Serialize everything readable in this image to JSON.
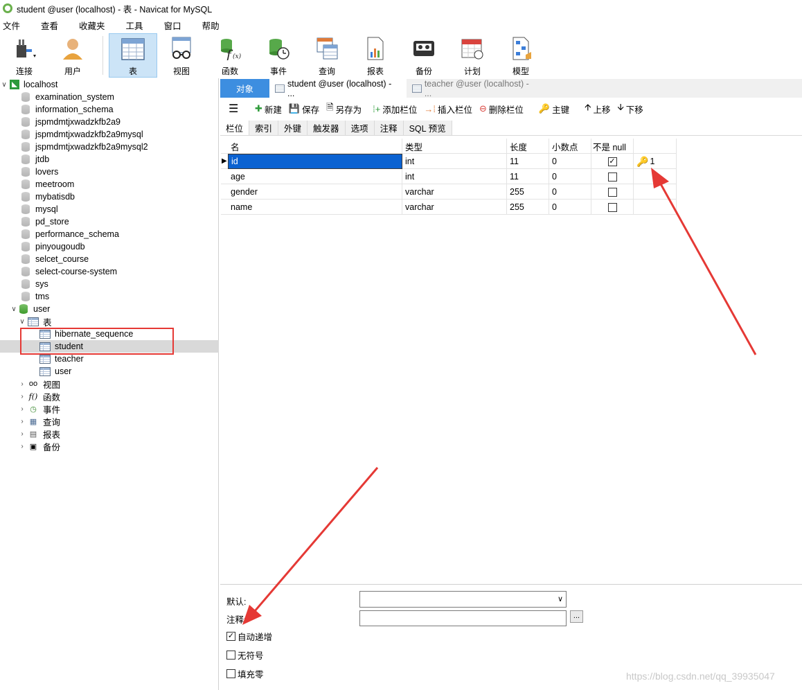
{
  "window": {
    "title": "student @user (localhost) - 表 - Navicat for MySQL"
  },
  "menu": [
    "文件",
    "查看",
    "收藏夹",
    "工具",
    "窗口",
    "帮助"
  ],
  "toolbar": {
    "connect": "连接",
    "user": "用户",
    "table": "表",
    "view": "视图",
    "function": "函数",
    "event": "事件",
    "query": "查询",
    "report": "报表",
    "backup": "备份",
    "schedule": "计划",
    "model": "模型"
  },
  "tree": {
    "host": "localhost",
    "databases": [
      "examination_system",
      "information_schema",
      "jspmdmtjxwadzkfb2a9",
      "jspmdmtjxwadzkfb2a9mysql",
      "jspmdmtjxwadzkfb2a9mysql2",
      "jtdb",
      "lovers",
      "meetroom",
      "mybatisdb",
      "mysql",
      "pd_store",
      "performance_schema",
      "pinyougoudb",
      "selcet_course",
      "select-course-system",
      "sys",
      "tms"
    ],
    "open_db": "user",
    "tables_folder": "表",
    "tables": [
      "hibernate_sequence",
      "student",
      "teacher",
      "user"
    ],
    "folders": [
      "视图",
      "函数",
      "事件",
      "查询",
      "报表",
      "备份"
    ]
  },
  "tabs": {
    "objects": "对象",
    "active": "student @user (localhost) - ...",
    "inactive": "teacher @user (localhost) - ..."
  },
  "editor_toolbar": {
    "new": "新建",
    "save": "保存",
    "save_as": "另存为",
    "add_field": "添加栏位",
    "insert_field": "插入栏位",
    "delete_field": "删除栏位",
    "primary_key": "主键",
    "move_up": "上移",
    "move_down": "下移"
  },
  "field_tabs": [
    "栏位",
    "索引",
    "外键",
    "触发器",
    "选项",
    "注释",
    "SQL 预览"
  ],
  "grid": {
    "headers": [
      "名",
      "类型",
      "长度",
      "小数点",
      "不是 null"
    ],
    "rows": [
      {
        "name": "id",
        "type": "int",
        "length": "11",
        "decimals": "0",
        "not_null": true,
        "key": "1"
      },
      {
        "name": "age",
        "type": "int",
        "length": "11",
        "decimals": "0",
        "not_null": false,
        "key": ""
      },
      {
        "name": "gender",
        "type": "varchar",
        "length": "255",
        "decimals": "0",
        "not_null": false,
        "key": ""
      },
      {
        "name": "name",
        "type": "varchar",
        "length": "255",
        "decimals": "0",
        "not_null": false,
        "key": ""
      }
    ]
  },
  "properties": {
    "default_label": "默认:",
    "comment_label": "注释:",
    "dots": "...",
    "auto_increment": "自动递增",
    "unsigned": "无符号",
    "zerofill": "填充零"
  },
  "watermark": "https://blog.csdn.net/qq_39935047",
  "colors": {
    "accent": "#3d8ee0",
    "annotation_red": "#e53935",
    "key_gold": "#e0a800"
  }
}
